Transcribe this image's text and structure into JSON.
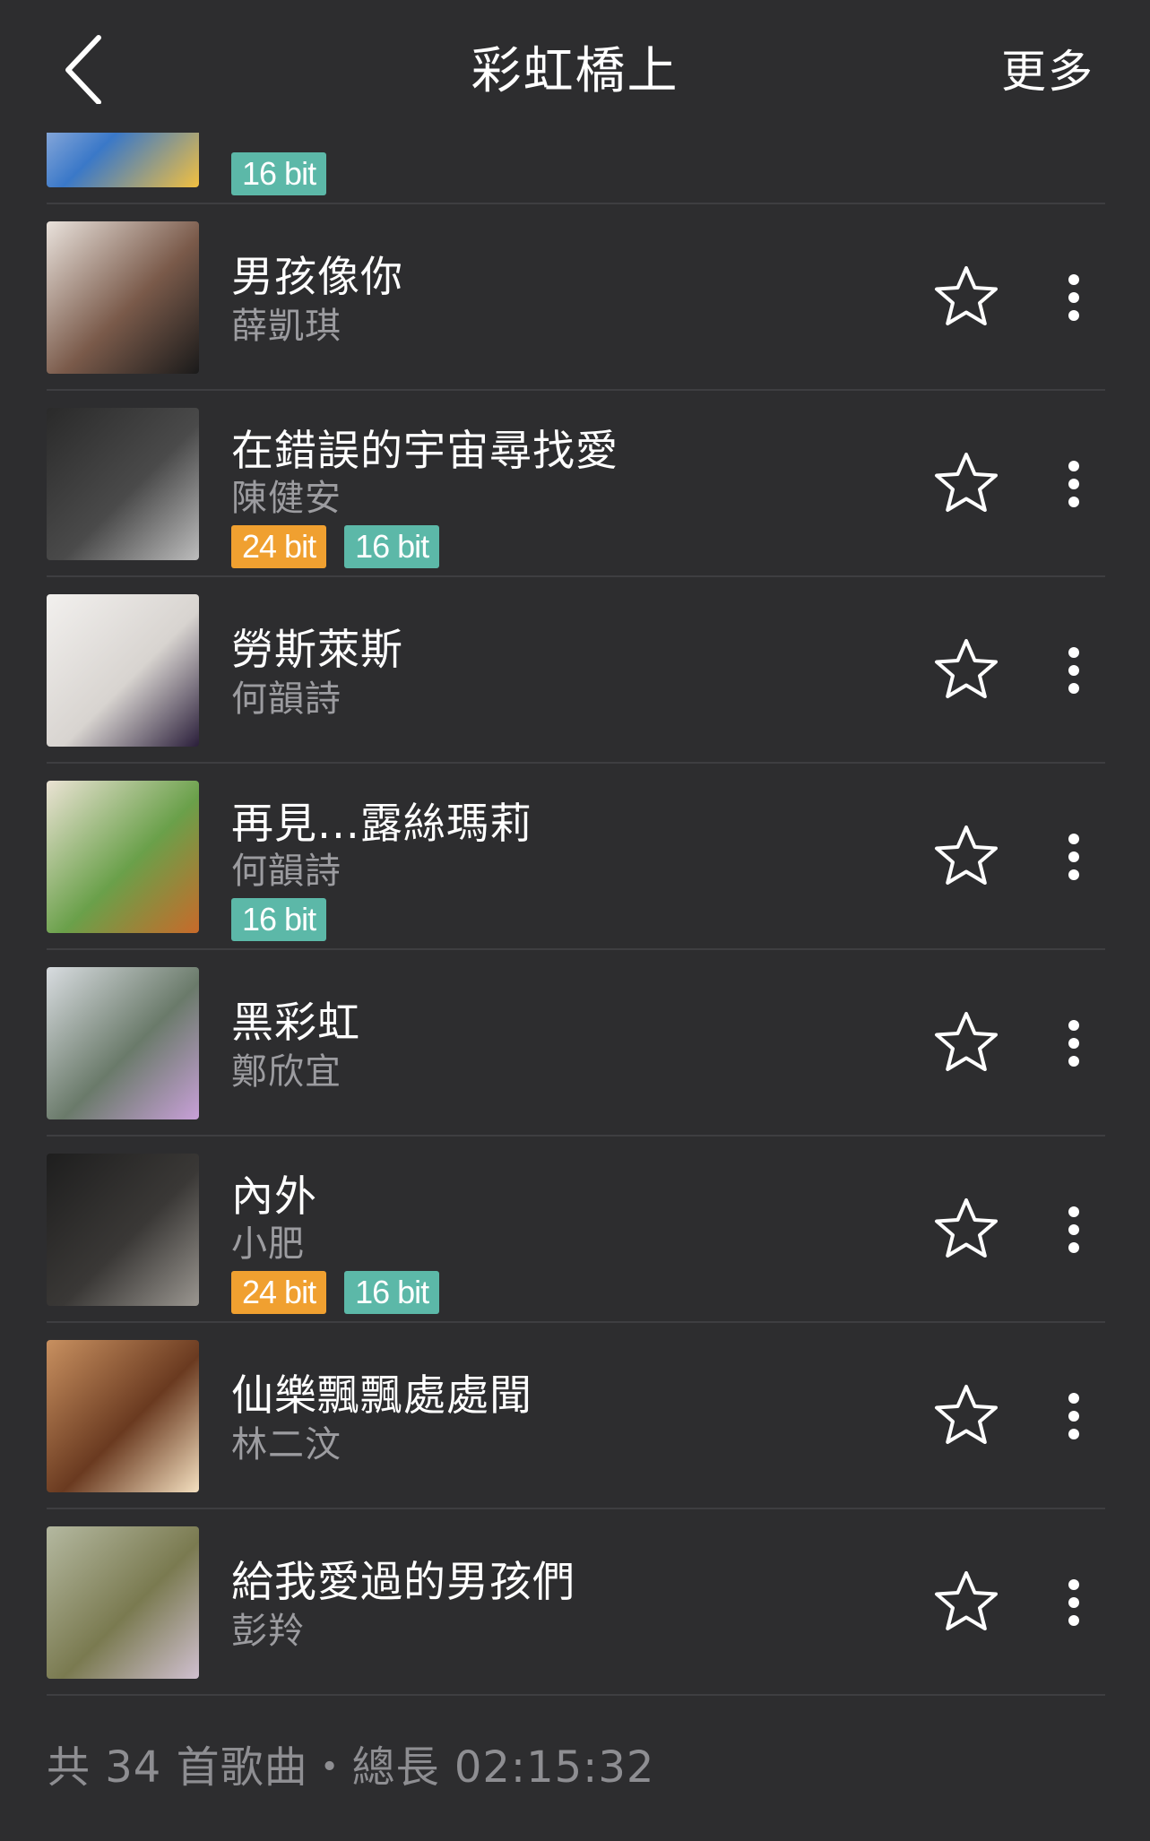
{
  "header": {
    "title": "彩虹橋上",
    "more_label": "更多"
  },
  "songs": [
    {
      "title": "",
      "artist": "",
      "badges": [
        "16 bit"
      ],
      "cover_colors": [
        "#e8e4f0",
        "#3a78c8",
        "#f2c040"
      ]
    },
    {
      "title": "男孩像你",
      "artist": "薛凱琪",
      "badges": [],
      "cover_colors": [
        "#e9e2dc",
        "#7a5a4a",
        "#1a1a1a"
      ]
    },
    {
      "title": "在錯誤的宇宙尋找愛",
      "artist": "陳健安",
      "badges": [
        "24 bit",
        "16 bit"
      ],
      "cover_colors": [
        "#2a2a2a",
        "#4a4a4a",
        "#bdbdbd"
      ]
    },
    {
      "title": "勞斯萊斯",
      "artist": "何韻詩",
      "badges": [],
      "cover_colors": [
        "#f2f0ee",
        "#d8d4d0",
        "#2a1e3a"
      ]
    },
    {
      "title": "再見...露絲瑪莉",
      "artist": "何韻詩",
      "badges": [
        "16 bit"
      ],
      "cover_colors": [
        "#ebe3d4",
        "#6aa04a",
        "#c86a2a"
      ]
    },
    {
      "title": "黑彩虹",
      "artist": "鄭欣宜",
      "badges": [],
      "cover_colors": [
        "#d8dce0",
        "#6a7a6a",
        "#c8a0d8"
      ]
    },
    {
      "title": "內外",
      "artist": "小肥",
      "badges": [
        "24 bit",
        "16 bit"
      ],
      "cover_colors": [
        "#1e1e1e",
        "#3a3836",
        "#9a9690"
      ]
    },
    {
      "title": "仙樂飄飄處處聞",
      "artist": "林二汶",
      "badges": [],
      "cover_colors": [
        "#c89060",
        "#6a3a20",
        "#f4e0c0"
      ]
    },
    {
      "title": "給我愛過的男孩們",
      "artist": "彭羚",
      "badges": [],
      "cover_colors": [
        "#b4b8a0",
        "#7a7a50",
        "#d0c0d0"
      ]
    }
  ],
  "footer": {
    "summary": "共 34 首歌曲・總長 02:15:32"
  },
  "colors": {
    "background": "#2d2d2f",
    "badge_24bit": "#f0a030",
    "badge_16bit": "#5cb8a8",
    "secondary_text": "#9c9ca0"
  },
  "icons": {
    "back": "chevron-left-icon",
    "favorite": "star-outline-icon",
    "menu": "more-vertical-icon"
  }
}
